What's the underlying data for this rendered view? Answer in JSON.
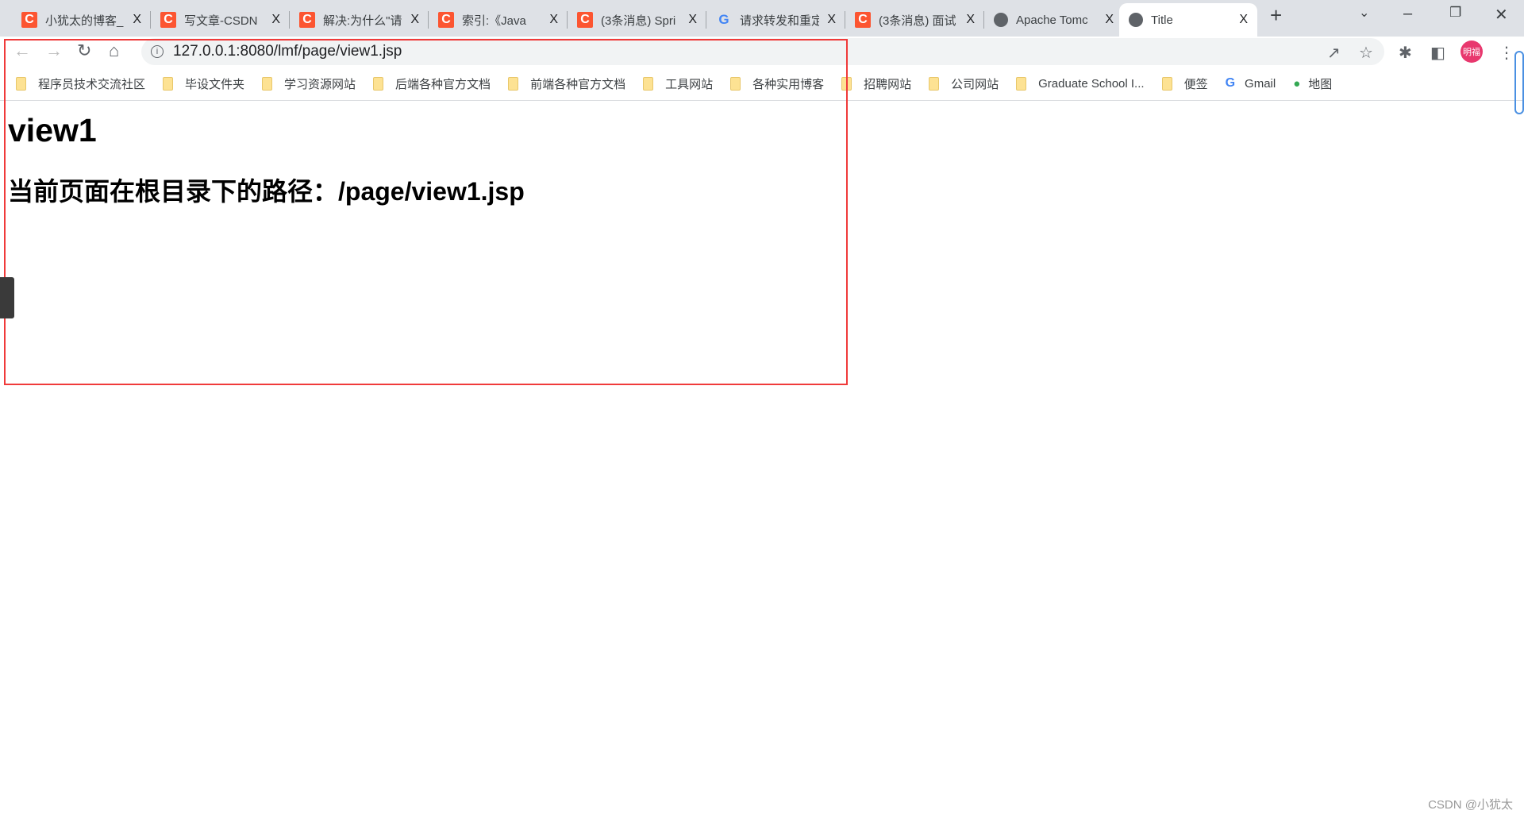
{
  "tabs": [
    {
      "title": "小犹太的博客_",
      "icon": "csdn-icon"
    },
    {
      "title": "写文章-CSDN",
      "icon": "csdn-icon"
    },
    {
      "title": "解决:为什么\"请",
      "icon": "csdn-icon"
    },
    {
      "title": "索引:《Java",
      "icon": "csdn-icon"
    },
    {
      "title": "(3条消息) Spri",
      "icon": "csdn-icon"
    },
    {
      "title": "请求转发和重定",
      "icon": "google-icon"
    },
    {
      "title": "(3条消息) 面试",
      "icon": "csdn-icon"
    },
    {
      "title": "Apache Tomc",
      "icon": "globe-icon"
    },
    {
      "title": "Title",
      "icon": "globe-icon",
      "active": true
    }
  ],
  "close_glyph": "X",
  "new_tab": "+",
  "address": {
    "url": "127.0.0.1:8080/lmf/page/view1.jsp"
  },
  "profile": {
    "initials": "明福",
    "color": "#e8386e"
  },
  "bookmarks": [
    "程序员技术交流社区",
    "毕设文件夹",
    "学习资源网站",
    "后端各种官方文档",
    "前端各种官方文档",
    "工具网站",
    "各种实用博客",
    "招聘网站",
    "公司网站",
    "Graduate School I...",
    "便签"
  ],
  "bookmark_gmail": "Gmail",
  "bookmark_maps": "地图",
  "page": {
    "heading": "view1",
    "subheading": "当前页面在根目录下的路径：/page/view1.jsp"
  },
  "annotation_color": "#f03a3a",
  "watermark": "CSDN @小犹太"
}
